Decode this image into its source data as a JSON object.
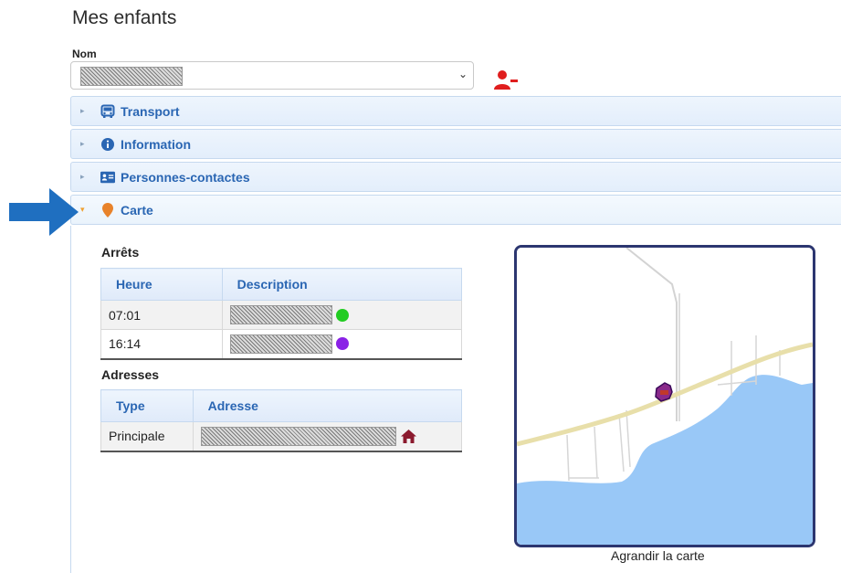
{
  "page": {
    "title": "Mes enfants"
  },
  "nom": {
    "label": "Nom"
  },
  "accordion": {
    "transport": "Transport",
    "information": "Information",
    "contacts": "Personnes-contactes",
    "carte": "Carte"
  },
  "arrets": {
    "heading": "Arrêts",
    "columns": [
      "Heure",
      "Description"
    ],
    "rows": [
      {
        "heure": "07:01",
        "dot_color": "#22cc22"
      },
      {
        "heure": "16:14",
        "dot_color": "#8a22e6"
      }
    ]
  },
  "adresses": {
    "heading": "Adresses",
    "columns": [
      "Type",
      "Adresse"
    ],
    "rows": [
      {
        "type": "Principale"
      }
    ]
  },
  "map": {
    "caption": "Agrandir la carte"
  },
  "colors": {
    "accent": "#2a66b3",
    "remove_user": "#e01e1e",
    "map_water": "#99c8f7",
    "map_road": "#e8dfaa",
    "map_frame": "#2c3670",
    "home_icon": "#8b1a2e",
    "arrow": "#1f6fc0"
  }
}
